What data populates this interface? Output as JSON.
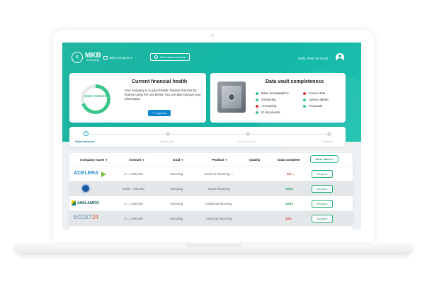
{
  "brand": {
    "name": "MKB",
    "tagline": "financiering",
    "accent": "#1fb6a0",
    "secondary_accent": "#0f88d1"
  },
  "header": {
    "company_label": "Blue Group B.V.",
    "advisor_button": "Give advisor access",
    "greeting": "Hello, Peter de Groot"
  },
  "health": {
    "title": "Current financial health",
    "gauge_label": "HIGH CHANCE",
    "gauge_fraction": 0.7,
    "description": "Your company is in good health. Review chances for finance using the tool below. You can also improve your information.",
    "improve_button": "Improve"
  },
  "vault": {
    "title": "Data vault completeness",
    "items_left": [
      {
        "label": "Basic demographics",
        "status": "complete",
        "color": "#3cc68a"
      },
      {
        "label": "Ownership",
        "status": "complete",
        "color": "#3cc68a"
      },
      {
        "label": "Accounting",
        "status": "missing",
        "color": "#d63a3a"
      },
      {
        "label": "ID documents",
        "status": "complete",
        "color": "#3cc68a"
      }
    ],
    "items_right": [
      {
        "label": "Invoice data",
        "status": "missing",
        "color": "#d63a3a"
      },
      {
        "label": "Advisor added",
        "status": "complete",
        "color": "#3cc68a"
      },
      {
        "label": "Proposals",
        "status": "complete",
        "color": "#3cc68a"
      }
    ]
  },
  "steps": [
    {
      "label": "Select amount",
      "active": true
    },
    {
      "label": "Select goal",
      "active": false
    },
    {
      "label": "Select product",
      "active": false
    },
    {
      "label": "Request",
      "active": false
    }
  ],
  "table": {
    "headers": {
      "company": "Company name",
      "amount": "Amount",
      "goal": "Goal",
      "product": "Product",
      "quality": "Quality",
      "data_complete": "Data complete"
    },
    "clear_filters": "Clear filters",
    "rows": [
      {
        "logo": "ACELERA",
        "amount": "0 - 1,000,000",
        "goal": "Factoring",
        "product": "American factoring",
        "data_complete": "3/6",
        "complete_status": "low",
        "request": "Request"
      },
      {
        "logo": "seal",
        "amount": "5,000 - 100,000",
        "goal": "Factoring",
        "product": "Export factoring",
        "data_complete": "10/10",
        "complete_status": "full",
        "request": "Request"
      },
      {
        "logo": "ABN·AMRO",
        "amount": "0 - 1,000,000",
        "goal": "Factoring",
        "product": "Traditional factoring",
        "data_complete": "10/10",
        "complete_status": "full",
        "request": "Request"
      },
      {
        "logo_main": "ECOZT",
        "logo_accent": "24",
        "amount": "0 - 1,000,000",
        "goal": "Factoring",
        "product": "American factoring",
        "data_complete": "2/10",
        "complete_status": "low",
        "request": "Request"
      }
    ]
  }
}
